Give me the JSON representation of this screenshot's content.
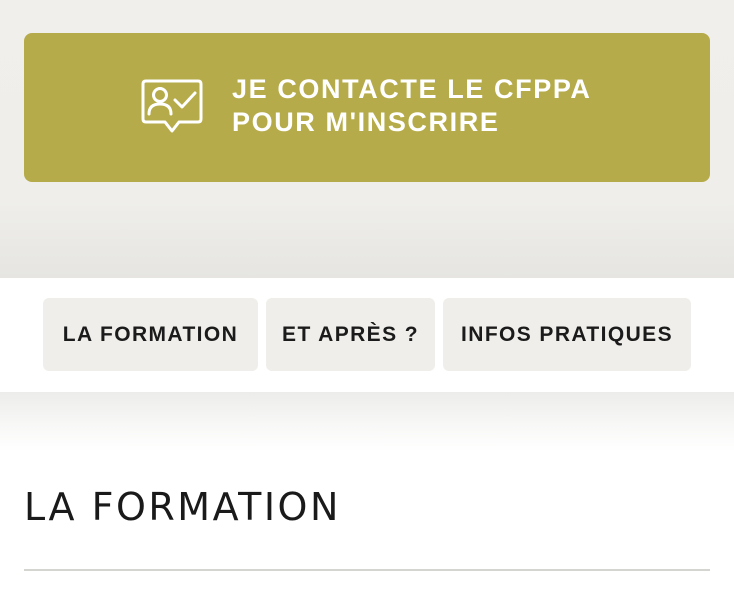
{
  "cta": {
    "line1": "JE CONTACTE LE CFPPA",
    "line2": "POUR M'INSCRIRE",
    "icon": "contact-chat-check-icon",
    "color": "#b6ab4a"
  },
  "tabs": [
    {
      "label": "LA FORMATION"
    },
    {
      "label": "ET APRÈS ?"
    },
    {
      "label": "INFOS PRATIQUES"
    }
  ],
  "section": {
    "title": "LA FORMATION"
  }
}
